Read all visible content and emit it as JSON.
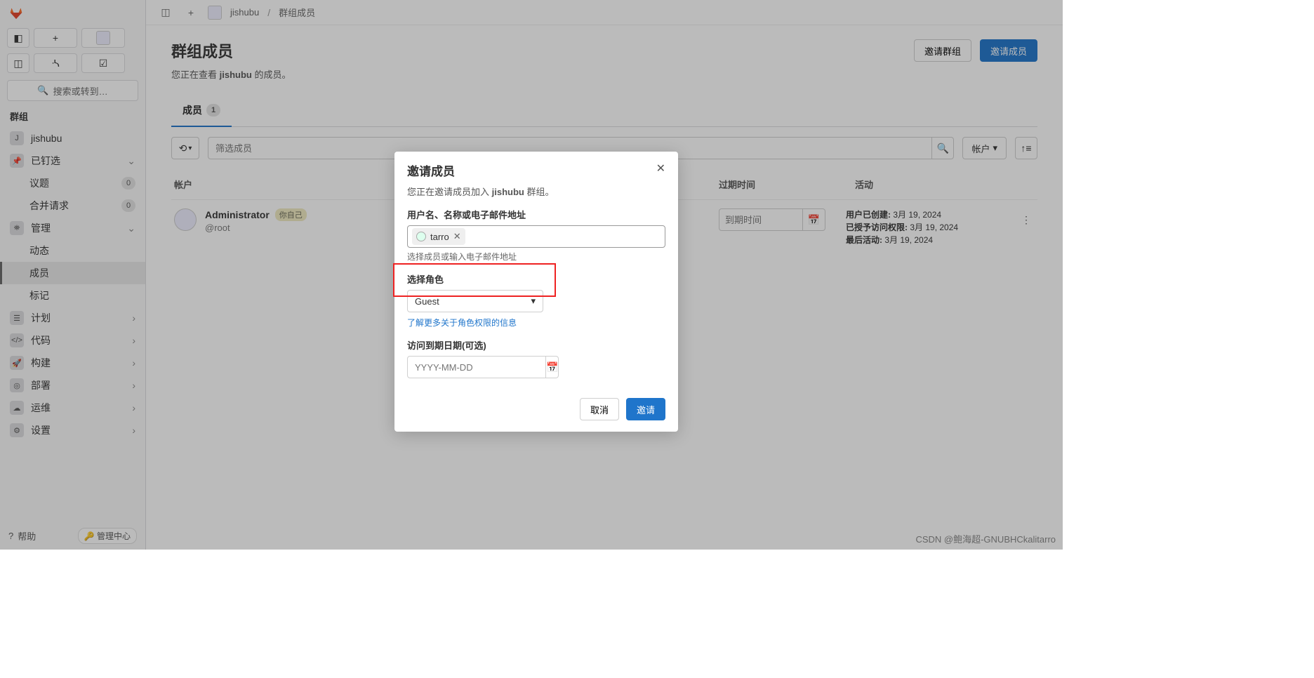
{
  "breadcrumb": {
    "group": "jishubu",
    "page": "群组成员"
  },
  "sidebar": {
    "search_placeholder": "搜索或转到…",
    "section_label": "群组",
    "group_name": "jishubu",
    "group_letter": "J",
    "pinned": {
      "label": "已钉选",
      "issues": "议题",
      "issues_count": "0",
      "mr": "合并请求",
      "mr_count": "0"
    },
    "manage": {
      "label": "管理",
      "activity": "动态",
      "members": "成员",
      "labels": "标记"
    },
    "plan": "计划",
    "code": "代码",
    "build": "构建",
    "deploy": "部署",
    "ops": "运维",
    "settings": "设置",
    "help": "帮助",
    "admin": "管理中心"
  },
  "header": {
    "title": "群组成员",
    "subtitle_prefix": "您正在查看 ",
    "subtitle_group": "jishubu",
    "subtitle_suffix": " 的成员。",
    "invite_group_btn": "邀请群组",
    "invite_member_btn": "邀请成员"
  },
  "tabs": {
    "members": "成员",
    "members_count": "1"
  },
  "toolbar": {
    "filter_placeholder": "筛选成员",
    "acct_label": "帐户"
  },
  "table": {
    "th_account": "帐户",
    "th_expiry": "过期时间",
    "th_activity": "活动",
    "row": {
      "name": "Administrator",
      "self_badge": "你自己",
      "handle": "@root",
      "expiry_placeholder": "到期时间",
      "activity_created_label": "用户已创建:",
      "activity_created_val": "3月 19, 2024",
      "activity_granted_label": "已授予访问权限:",
      "activity_granted_val": "3月 19, 2024",
      "activity_last_label": "最后活动:",
      "activity_last_val": "3月 19, 2024"
    }
  },
  "modal": {
    "title": "邀请成员",
    "desc_prefix": "您正在邀请成员加入 ",
    "desc_group": "jishubu",
    "desc_suffix": " 群组。",
    "label_user": "用户名、名称或电子邮件地址",
    "token_name": "tarro",
    "hint_user": "选择成员或输入电子邮件地址",
    "label_role": "选择角色",
    "role_value": "Guest",
    "link_role": "了解更多关于角色权限的信息",
    "label_date": "访问到期日期(可选)",
    "date_placeholder": "YYYY-MM-DD",
    "btn_cancel": "取消",
    "btn_confirm": "邀请"
  },
  "watermark": "CSDN @鲍海超-GNUBHCkalitarro"
}
